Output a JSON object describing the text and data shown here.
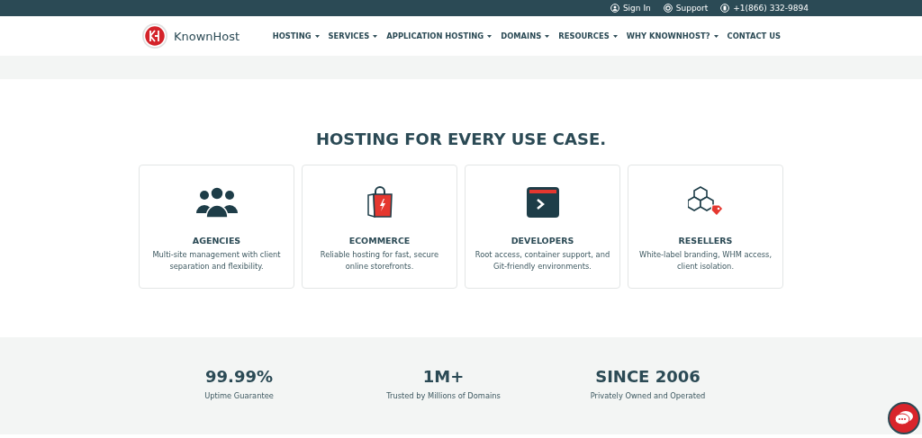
{
  "top_bar": {
    "links": [
      {
        "kind": "user",
        "label": "Sign In"
      },
      {
        "kind": "support",
        "label": "Support"
      },
      {
        "kind": "phone",
        "label": "+1(866) 332-9894"
      }
    ]
  },
  "header": {
    "logo_text": "KnownHost",
    "nav": [
      {
        "label": "HOSTING",
        "has_menu": true
      },
      {
        "label": "SERVICES",
        "has_menu": true
      },
      {
        "label": "APPLICATION HOSTING",
        "has_menu": true
      },
      {
        "label": "DOMAINS",
        "has_menu": true
      },
      {
        "label": "RESOURCES",
        "has_menu": true
      },
      {
        "label": "WHY KNOWNHOST?",
        "has_menu": true
      },
      {
        "label": "CONTACT US",
        "has_menu": false
      }
    ]
  },
  "use_cases": {
    "heading": "HOSTING FOR EVERY USE CASE.",
    "cards": [
      {
        "kind": "people",
        "title": "AGENCIES",
        "text": "Multi-site management with client separation and flexibility."
      },
      {
        "kind": "bag",
        "title": "ECOMMERCE",
        "text": "Reliable hosting for fast, secure online storefronts."
      },
      {
        "kind": "terminal",
        "title": "DEVELOPERS",
        "text": "Root access, container support, and Git-friendly environments."
      },
      {
        "kind": "cubes",
        "title": "RESELLERS",
        "text": "White-label branding, WHM access, client isolation."
      }
    ]
  },
  "stats": [
    {
      "value": "99.99%",
      "label": "Uptime Guarantee"
    },
    {
      "value": "1M+",
      "label": "Trusted by Millions of Domains"
    },
    {
      "value": "SINCE 2006",
      "label": "Privately Owned and Operated"
    }
  ]
}
